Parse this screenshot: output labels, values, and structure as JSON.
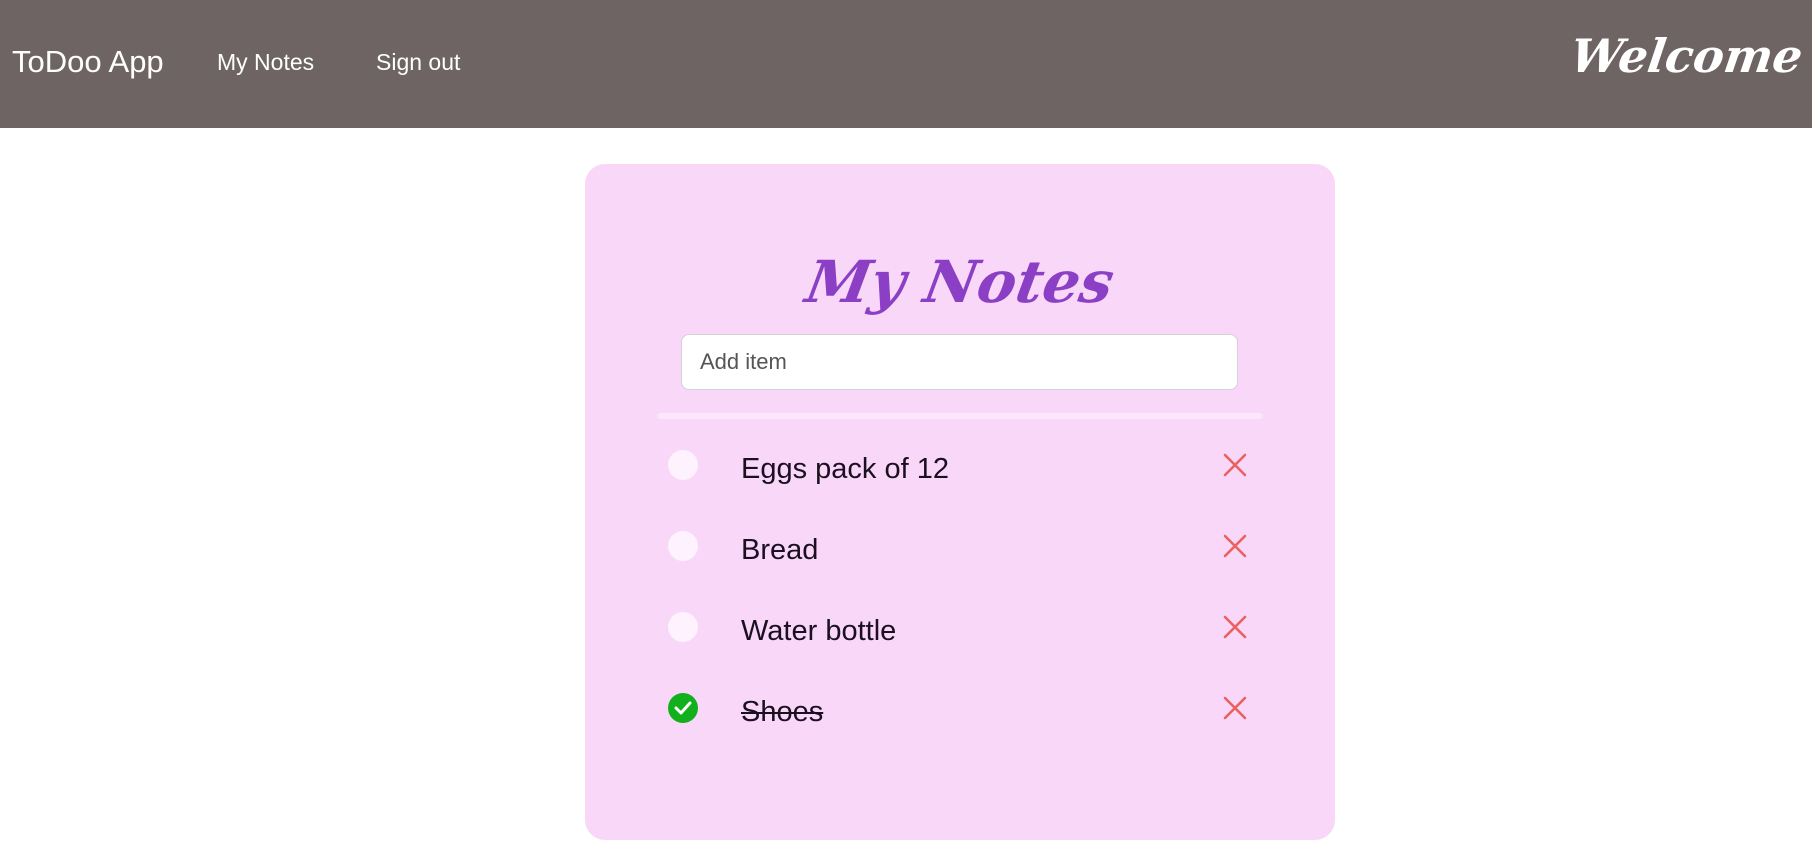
{
  "navbar": {
    "brand": "ToDoo App",
    "links": [
      {
        "label": "My Notes"
      },
      {
        "label": "Sign out"
      }
    ],
    "welcome": "Welcome"
  },
  "card": {
    "title": "My Notes",
    "input_placeholder": "Add item",
    "input_value": "",
    "items": [
      {
        "text": "Eggs pack of 12",
        "done": false
      },
      {
        "text": "Bread",
        "done": false
      },
      {
        "text": "Water bottle",
        "done": false
      },
      {
        "text": "Shoes",
        "done": true
      }
    ]
  },
  "colors": {
    "navbar_bg": "#6e6464",
    "card_bg": "#f9d7f9",
    "title": "#8a3fc4",
    "check_done": "#12b01d",
    "delete": "#e8625f"
  },
  "icons": {
    "check_done": "check-mark-icon",
    "delete": "x-close-icon"
  }
}
